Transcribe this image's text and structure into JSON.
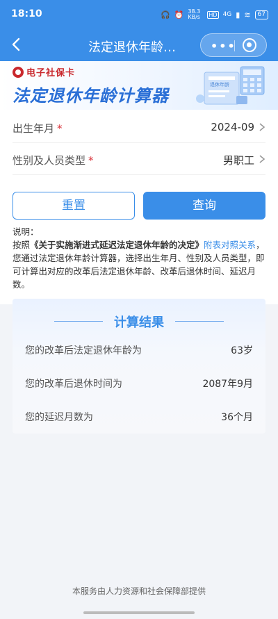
{
  "status_bar": {
    "time": "18:10",
    "speed": "38.3 KB/s",
    "hd": "HD",
    "network": "4G",
    "battery": "67"
  },
  "nav": {
    "title": "法定退休年龄…",
    "more_icon": "more-dots-icon",
    "close_icon": "target-close-icon"
  },
  "banner": {
    "brand": "电子社保卡",
    "title": "法定退休年龄计算器",
    "illustration_text": "退休年龄"
  },
  "form": {
    "birth": {
      "label": "出生年月",
      "required_mark": "*",
      "value": "2024-09"
    },
    "type": {
      "label": "性别及人员类型",
      "required_mark": "*",
      "value": "男职工"
    }
  },
  "buttons": {
    "reset": "重置",
    "query": "查询"
  },
  "note": {
    "heading": "说明：",
    "prefix": "按照",
    "doc": "《关于实施渐进式延迟法定退休年龄的决定》",
    "link": "附表对照关系",
    "body": "，您通过法定退休年龄计算器，选择出生年月、性别及人员类型，即可计算出对应的改革后法定退休年龄、改革后退休时间、延迟月数。"
  },
  "result": {
    "title": "计算结果",
    "rows": [
      {
        "label": "您的改革后法定退休年龄为",
        "value": "63岁"
      },
      {
        "label": "您的改革后退休时间为",
        "value": "2087年9月"
      },
      {
        "label": "您的延迟月数为",
        "value": "36个月"
      }
    ]
  },
  "footer": "本服务由人力资源和社会保障部提供",
  "colors": {
    "primary": "#3a8ee8",
    "brand_red": "#c9282d",
    "required": "#d9323a"
  }
}
